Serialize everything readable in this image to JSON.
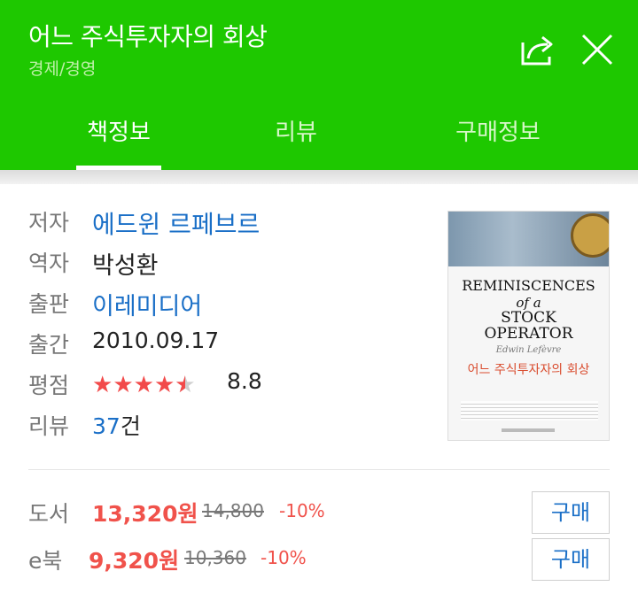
{
  "header": {
    "title": "어느 주식투자자의 회상",
    "category": "경제/경영"
  },
  "tabs": [
    {
      "label": "책정보",
      "active": true
    },
    {
      "label": "리뷰",
      "active": false
    },
    {
      "label": "구매정보",
      "active": false
    }
  ],
  "book": {
    "author_label": "저자",
    "author": "에드윈 르페브르",
    "translator_label": "역자",
    "translator": "박성환",
    "publisher_label": "출판",
    "publisher": "이레미디어",
    "pubdate_label": "출간",
    "pubdate": "2010.09.17",
    "rating_label": "평점",
    "rating_stars": 4.4,
    "rating": "8.8",
    "review_label": "리뷰",
    "review_count": "37",
    "review_unit": "건"
  },
  "cover": {
    "line1": "REMINISCENCES",
    "line2": "of a",
    "line3": "STOCK",
    "line4": "OPERATOR",
    "author": "Edwin Lefèvre",
    "title_ko": "어느 주식투자자의 회상"
  },
  "prices": [
    {
      "type": "도서",
      "price": "13,320원",
      "original": "14,800",
      "discount": "-10%",
      "buy_label": "구매"
    },
    {
      "type": "e북",
      "price": "9,320원",
      "original": "10,360",
      "discount": "-10%",
      "buy_label": "구매"
    }
  ],
  "colors": {
    "brand_green": "#1ec800",
    "link_blue": "#1a6fc7",
    "price_red": "#f0524b"
  },
  "icons": [
    "share-icon",
    "close-icon",
    "star-icon"
  ]
}
